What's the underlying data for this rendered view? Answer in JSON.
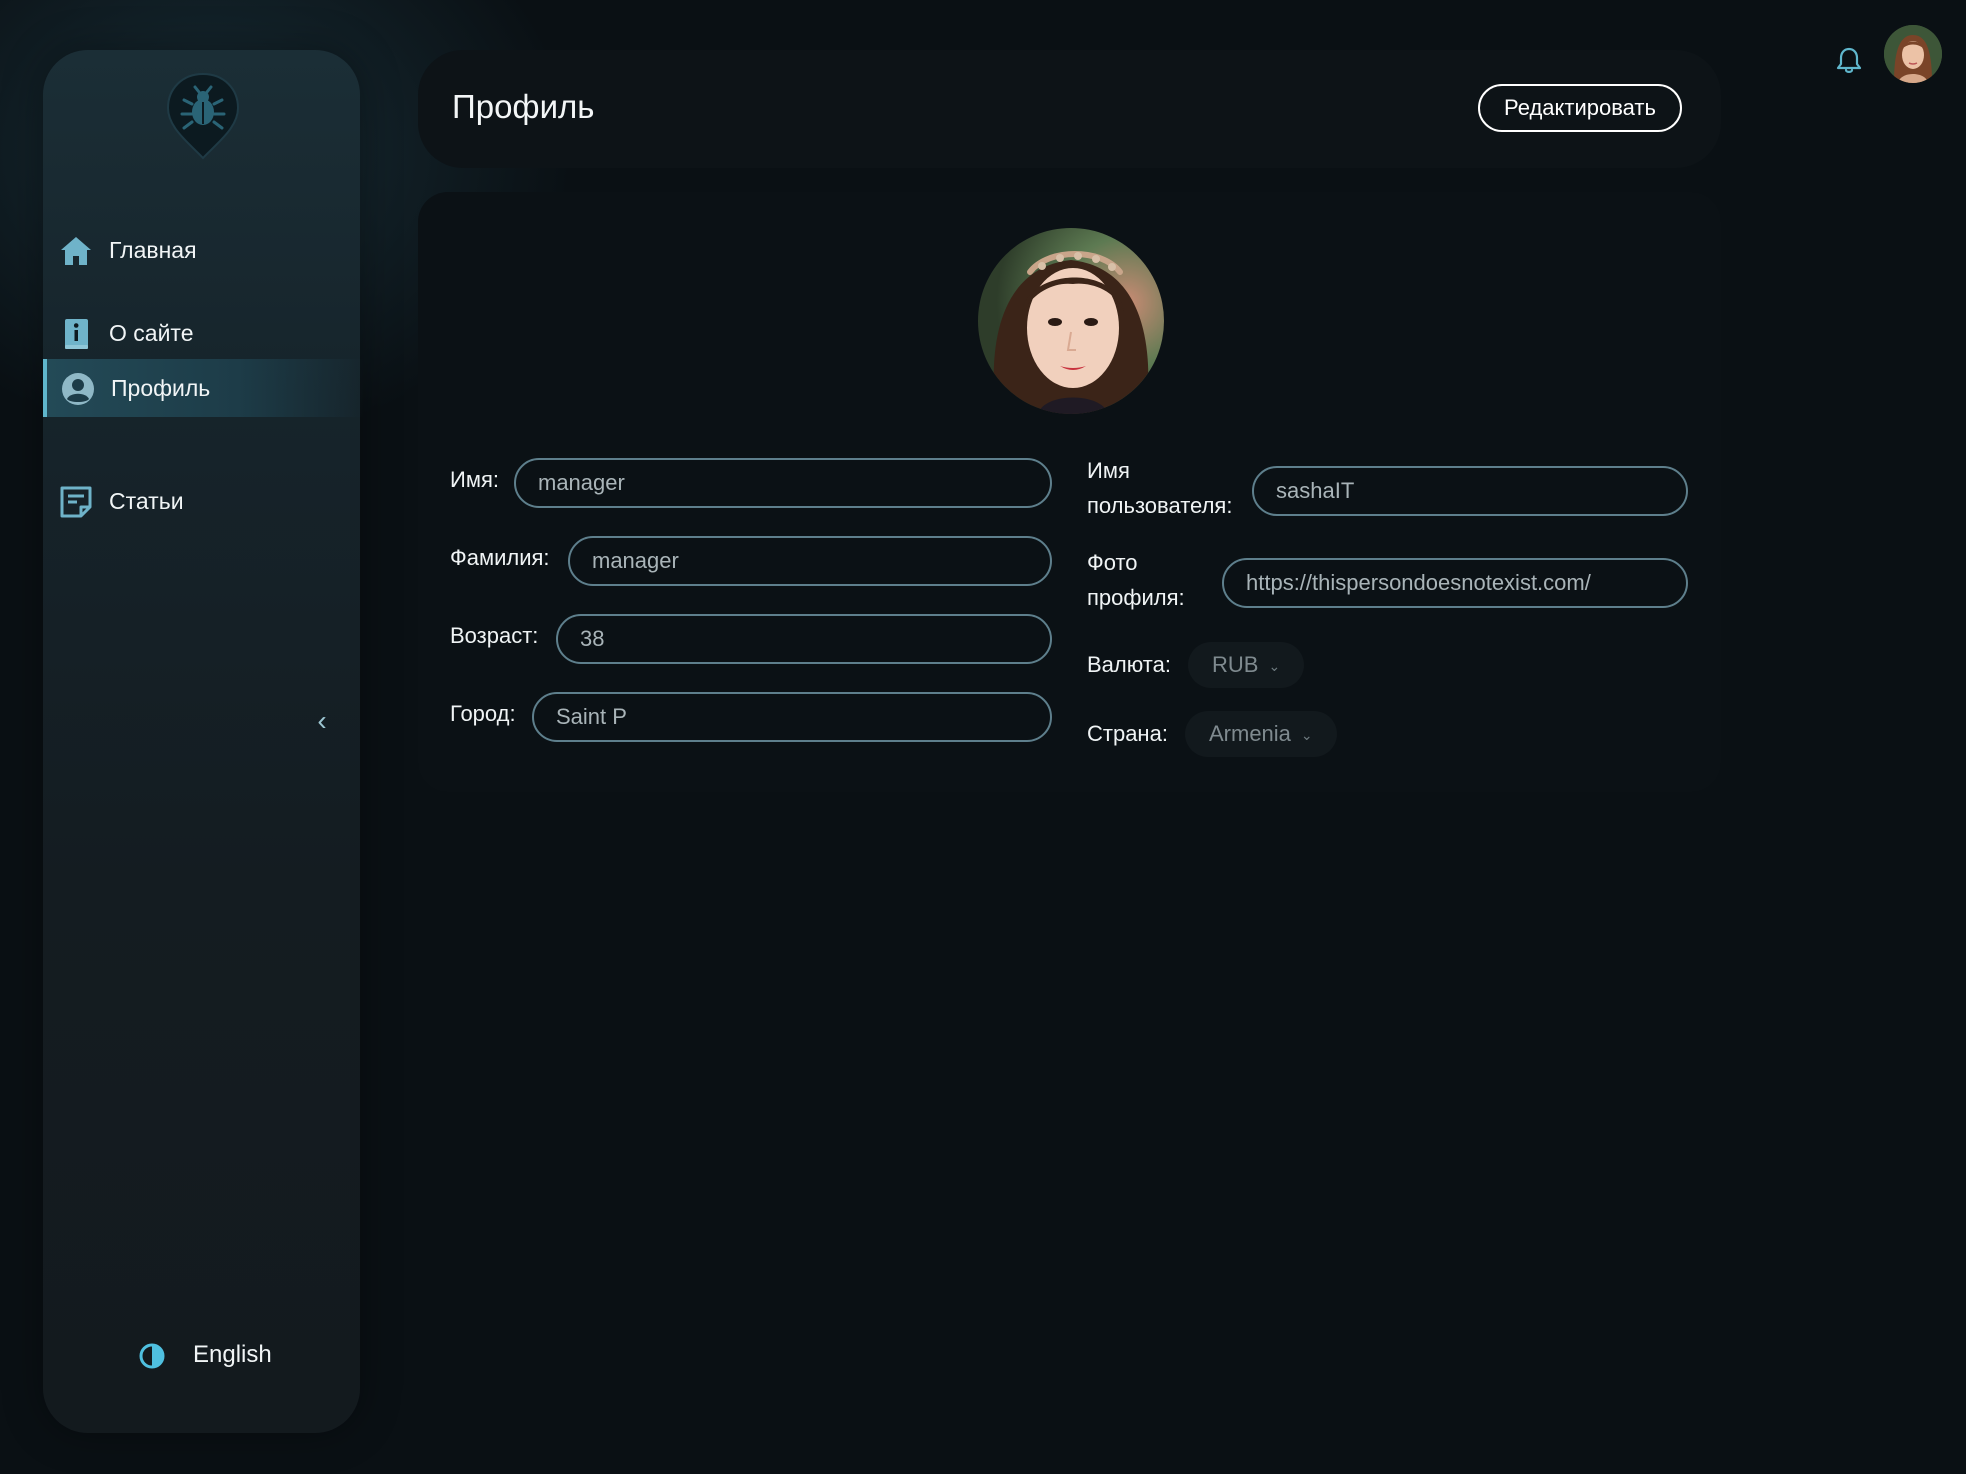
{
  "sidebar": {
    "logo_icon": "bug-pin-icon",
    "items": [
      {
        "label": "Главная",
        "icon": "home-icon",
        "active": false
      },
      {
        "label": "О сайте",
        "icon": "info-book-icon",
        "active": false
      },
      {
        "label": "Профиль",
        "icon": "user-circle-icon",
        "active": true
      },
      {
        "label": "Статьи",
        "icon": "article-icon",
        "active": false
      }
    ],
    "collapse_label": "‹",
    "theme_icon": "half-circle-icon",
    "language_label": "English"
  },
  "header": {
    "title": "Профиль",
    "edit_label": "Редактировать"
  },
  "topbar": {
    "bell_icon": "bell-icon",
    "avatar_icon": "user-avatar"
  },
  "profile": {
    "first_name": {
      "label": "Имя:",
      "value": "manager"
    },
    "last_name": {
      "label": "Фамилия:",
      "value": "manager"
    },
    "age": {
      "label": "Возраст:",
      "value": "38"
    },
    "city": {
      "label": "Город:",
      "value": "Saint P"
    },
    "username": {
      "label_line1": "Имя",
      "label_line2": "пользователя:",
      "value": "sashaIT"
    },
    "avatar_url": {
      "label_line1": "Фото",
      "label_line2": "профиля:",
      "value": "https://thispersondoesnotexist.com/"
    },
    "currency": {
      "label": "Валюта:",
      "value": "RUB"
    },
    "country": {
      "label": "Страна:",
      "value": "Armenia"
    }
  },
  "colors": {
    "background": "#0a1014",
    "sidebar": "#16242b",
    "accent": "#5fb6cc",
    "input_border": "#5e7f8c"
  }
}
